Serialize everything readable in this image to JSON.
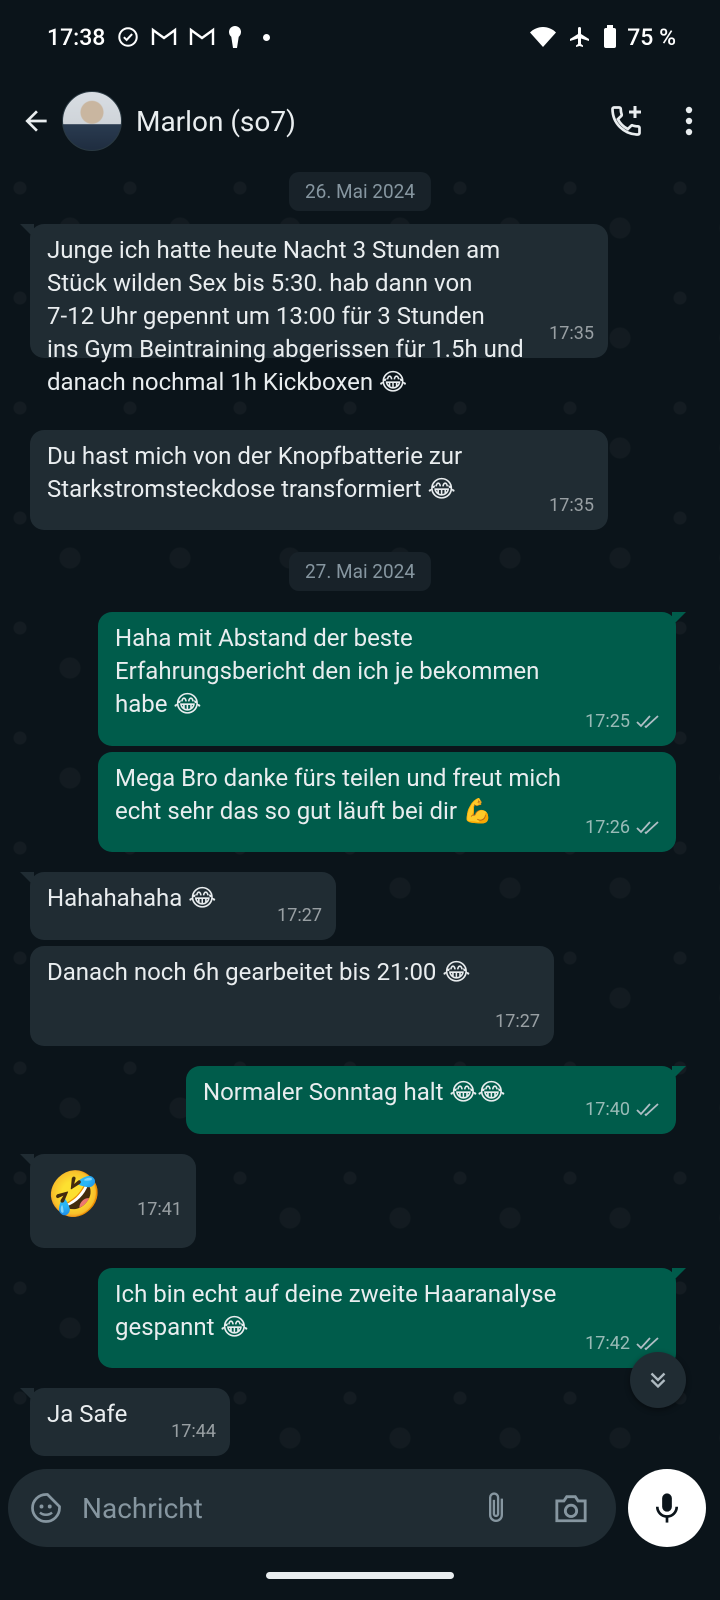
{
  "status_bar": {
    "time": "17:38",
    "battery": "75 %",
    "icons": [
      "check-circle-icon",
      "gmail-icon",
      "gmail-icon",
      "keyhole-icon",
      "dot-icon",
      "wifi-icon",
      "airplane-icon",
      "battery-icon"
    ]
  },
  "header": {
    "contact_name": "Marlon (so7)",
    "icons": [
      "back-arrow-icon",
      "avatar",
      "add-call-icon",
      "more-vert-icon"
    ]
  },
  "chat": {
    "date_chips": [
      "26. Mai 2024",
      "27. Mai 2024"
    ],
    "messages": [
      {
        "dir": "in",
        "text": "Junge ich hatte heute Nacht 3 Stunden am\nStück wilden Sex bis 5:30. hab dann von\n7-12 Uhr gepennt um 13:00 für 3 Stunden\nins Gym Beintraining abgerissen für 1.5h und\ndanach nochmal 1h Kickboxen 😂",
        "time": "17:35"
      },
      {
        "dir": "in",
        "text": "Du hast mich von der Knopfbatterie zur\nStarkstromsteckdose transformiert 😂",
        "time": "17:35"
      },
      {
        "dir": "out",
        "text": "Haha mit Abstand der beste\nErfahrungsbericht den ich je bekommen\nhabe 😂",
        "time": "17:25"
      },
      {
        "dir": "out",
        "text": "Mega Bro danke fürs teilen und freut mich\necht sehr das so gut läuft bei dir 💪",
        "time": "17:26"
      },
      {
        "dir": "in",
        "text": "Hahahahaha 😂",
        "time": "17:27"
      },
      {
        "dir": "in",
        "text": "Danach noch 6h gearbeitet bis 21:00 😂",
        "time": "17:27"
      },
      {
        "dir": "out",
        "text": "Normaler Sonntag halt 😂😂",
        "time": "17:40"
      },
      {
        "dir": "in",
        "text": "🤣",
        "time": "17:41"
      },
      {
        "dir": "out",
        "text": "Ich bin echt auf deine zweite Haaranalyse\ngespannt 😂",
        "time": "17:42"
      },
      {
        "dir": "in",
        "text": "Ja Safe",
        "time": "17:44"
      }
    ]
  },
  "input": {
    "placeholder": "Nachricht",
    "icons": [
      "sticker-icon",
      "attach-icon",
      "camera-icon",
      "mic-icon"
    ]
  },
  "colors": {
    "background": "#0b141a",
    "incoming_bubble": "#202c33",
    "outgoing_bubble": "#005c4b",
    "read_ticks": "#8696a0"
  }
}
